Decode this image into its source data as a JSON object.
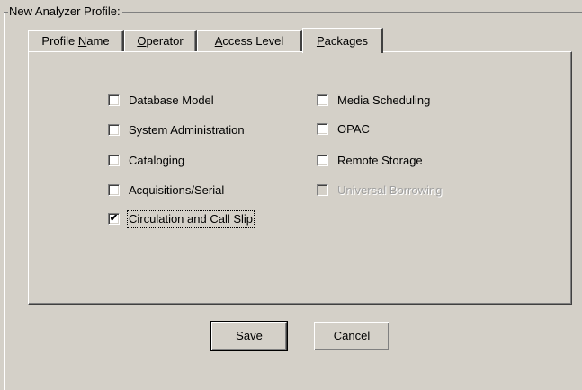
{
  "groupbox": {
    "title": "New Analyzer Profile:"
  },
  "tabs": [
    {
      "pre": "Profile ",
      "acc": "N",
      "post": "ame",
      "active": false
    },
    {
      "pre": "",
      "acc": "O",
      "post": "perator",
      "active": false
    },
    {
      "pre": "",
      "acc": "A",
      "post": "ccess Level",
      "active": false
    },
    {
      "pre": "",
      "acc": "P",
      "post": "ackages",
      "active": true
    }
  ],
  "packages": {
    "left": [
      {
        "label": "Database Model",
        "checked": false,
        "enabled": true
      },
      {
        "label": "System Administration",
        "checked": false,
        "enabled": true
      },
      {
        "label": "Cataloging",
        "checked": false,
        "enabled": true
      },
      {
        "label": "Acquisitions/Serial",
        "checked": false,
        "enabled": true
      },
      {
        "label": "Circulation and Call Slip",
        "checked": true,
        "enabled": true,
        "focused": true
      }
    ],
    "right": [
      {
        "label": "Media Scheduling",
        "checked": false,
        "enabled": true
      },
      {
        "label": "OPAC",
        "checked": false,
        "enabled": true
      },
      {
        "label": "Remote Storage",
        "checked": false,
        "enabled": true
      },
      {
        "label": "Universal Borrowing",
        "checked": false,
        "enabled": false
      }
    ],
    "check_glyph": "✔"
  },
  "buttons": {
    "save": {
      "acc": "S",
      "post": "ave"
    },
    "cancel": {
      "acc": "C",
      "post": "ancel"
    }
  },
  "colors": {
    "face": "#d4d0c8",
    "disabled_text": "#a0a0a0"
  }
}
